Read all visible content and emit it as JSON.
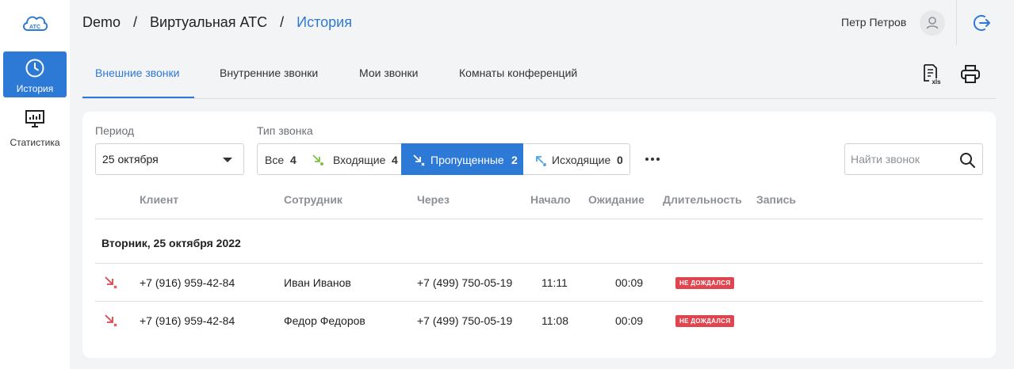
{
  "sidebar": {
    "logo_text": "АТС",
    "items": [
      {
        "label": "История",
        "icon": "clock-icon",
        "active": true
      },
      {
        "label": "Статистика",
        "icon": "chart-board-icon",
        "active": false
      }
    ]
  },
  "header": {
    "breadcrumbs": [
      "Demo",
      "Виртуальная АТС",
      "История"
    ],
    "separator": "/",
    "user_name": "Петр Петров"
  },
  "tabs": [
    {
      "label": "Внешние звонки",
      "active": true
    },
    {
      "label": "Внутренние звонки",
      "active": false
    },
    {
      "label": "Мои звонки",
      "active": false
    },
    {
      "label": "Комнаты конференций",
      "active": false
    }
  ],
  "toolbar": {
    "export_icon": "xls-export-icon",
    "export_label": "xls",
    "print_icon": "printer-icon"
  },
  "filters": {
    "period_label": "Период",
    "period_value": "25 октября",
    "type_label": "Тип звонка",
    "types": [
      {
        "label": "Все",
        "count": "4",
        "active": false
      },
      {
        "label": "Входящие",
        "count": "4",
        "active": false
      },
      {
        "label": "Пропущенные",
        "count": "2",
        "active": true
      },
      {
        "label": "Исходящие",
        "count": "0",
        "active": false
      }
    ],
    "search_placeholder": "Найти звонок"
  },
  "table": {
    "columns": [
      "Клиент",
      "Сотрудник",
      "Через",
      "Начало",
      "Ожидание",
      "Длительность",
      "Запись"
    ],
    "group_title": "Вторник, 25 октября 2022",
    "rows": [
      {
        "client": "+7 (916) 959-42-84",
        "employee": "Иван Иванов",
        "via": "+7 (499) 750-05-19",
        "start": "11:11",
        "wait": "00:09",
        "status": "НЕ ДОЖДАЛСЯ"
      },
      {
        "client": "+7 (916) 959-42-84",
        "employee": "Федор Федоров",
        "via": "+7 (499) 750-05-19",
        "start": "11:08",
        "wait": "00:09",
        "status": "НЕ ДОЖДАЛСЯ"
      }
    ]
  },
  "colors": {
    "accent": "#2d79d6",
    "missed": "#e0444f",
    "incoming": "#7cc242",
    "outgoing": "#4aa8e8"
  }
}
